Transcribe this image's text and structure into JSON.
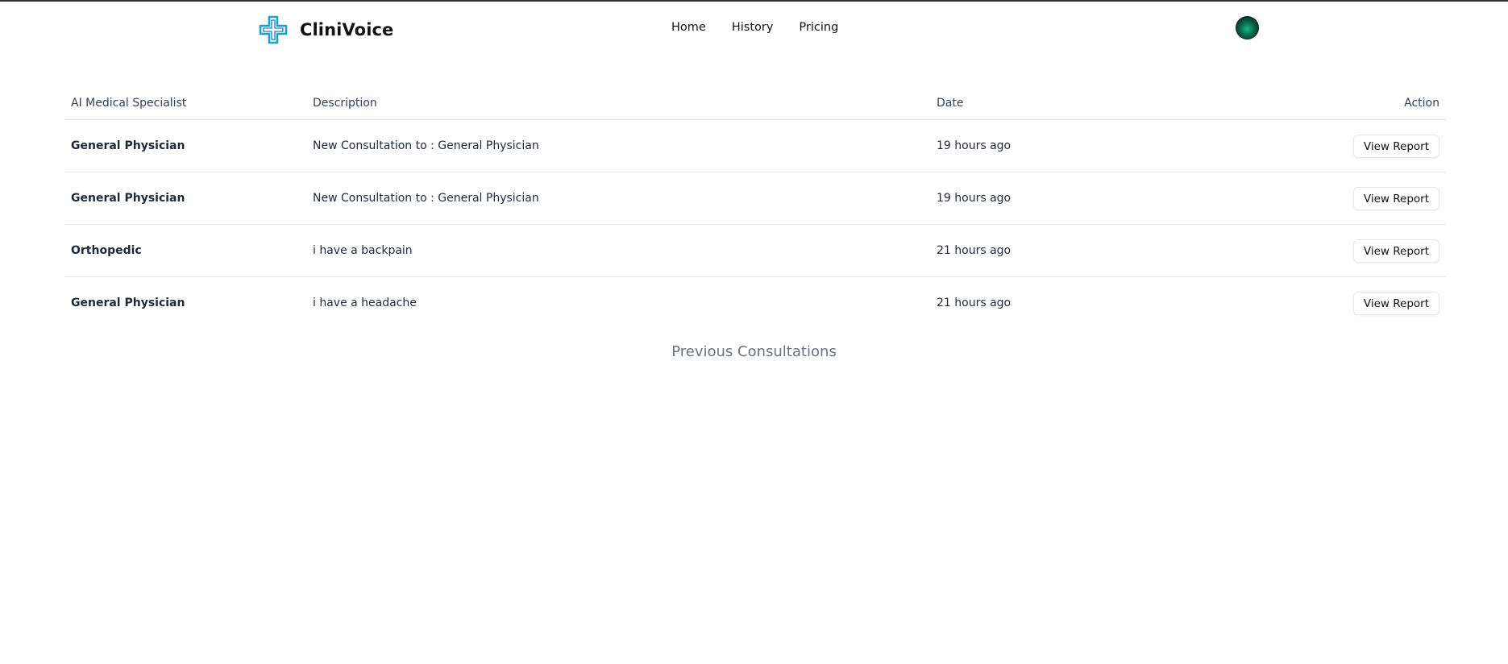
{
  "app": {
    "name": "CliniVoice",
    "logo_icon": "medical-cross-icon",
    "accent_color": "#1a9fd0"
  },
  "nav": {
    "items": [
      "Home",
      "History",
      "Pricing"
    ]
  },
  "user": {
    "avatar_icon": "user-avatar"
  },
  "table": {
    "headers": {
      "specialist": "AI Medical Specialist",
      "description": "Description",
      "date": "Date",
      "action": "Action"
    },
    "rows": [
      {
        "specialist": "General Physician",
        "description": "New Consultation to : General Physician",
        "date": "19 hours ago",
        "action": "View Report"
      },
      {
        "specialist": "General Physician",
        "description": "New Consultation to : General Physician",
        "date": "19 hours ago",
        "action": "View Report"
      },
      {
        "specialist": "Orthopedic",
        "description": "i have a backpain",
        "date": "21 hours ago",
        "action": "View Report"
      },
      {
        "specialist": "General Physician",
        "description": "i have a headache",
        "date": "21 hours ago",
        "action": "View Report"
      }
    ],
    "caption": "Previous Consultations"
  }
}
